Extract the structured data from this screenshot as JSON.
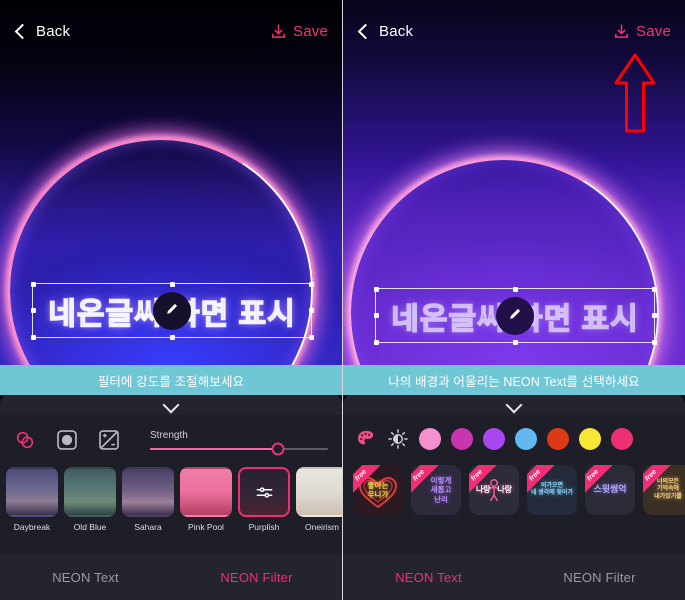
{
  "panels": {
    "left": {
      "topbar": {
        "back_label": "Back",
        "save_label": "Save",
        "back_icon": "chevron-left-icon",
        "save_icon": "download-save-icon"
      },
      "canvas": {
        "neon_text": "네온글씨 화면 표시",
        "edit_icon": "pencil-icon"
      },
      "banner": {
        "text": "필터에 강도를 조절해보세요"
      },
      "sheet": {
        "grabber_icon": "chevron-down-icon",
        "tools": [
          {
            "name": "blend-circles-icon",
            "active": true
          },
          {
            "name": "vignette-icon",
            "active": false
          },
          {
            "name": "exposure-icon",
            "active": false
          }
        ],
        "slider": {
          "label": "Strength",
          "value": 72
        },
        "filters": [
          {
            "label": "Daybreak",
            "selected": false
          },
          {
            "label": "Old Blue",
            "selected": false
          },
          {
            "label": "Sahara",
            "selected": false
          },
          {
            "label": "Pink Pool",
            "selected": false
          },
          {
            "label": "Purplish",
            "selected": true,
            "badge_icon": "sliders-adjust-icon"
          },
          {
            "label": "Oneirism",
            "selected": false
          }
        ]
      },
      "tabs": [
        {
          "label": "NEON Text",
          "active": false
        },
        {
          "label": "NEON Filter",
          "active": true
        }
      ]
    },
    "right": {
      "topbar": {
        "back_label": "Back",
        "save_label": "Save",
        "back_icon": "chevron-left-icon",
        "save_icon": "download-save-icon"
      },
      "annotation": {
        "icon": "red-up-arrow-annotation",
        "color": "#ff0000"
      },
      "canvas": {
        "neon_text": "네온글씨 화면 표시",
        "edit_icon": "pencil-icon"
      },
      "banner": {
        "text": "나의 배경과 어울리는 NEON Text를 선택하세요"
      },
      "sheet": {
        "grabber_icon": "chevron-down-icon",
        "tools": [
          {
            "name": "palette-icon"
          },
          {
            "name": "brightness-icon"
          }
        ],
        "colors": [
          {
            "hex": "#f48fd0"
          },
          {
            "hex": "#c935ae"
          },
          {
            "hex": "#ab47f0"
          },
          {
            "hex": "#62b8f0"
          },
          {
            "hex": "#dc3a17"
          },
          {
            "hex": "#f7e636"
          },
          {
            "hex": "#ef2f74"
          }
        ],
        "stickers": [
          {
            "badge": "free",
            "text": "좋아는\n우니가",
            "color": "#f7d64e"
          },
          {
            "badge": "free",
            "text": "이렇게\n새롭고\n난리",
            "color": "#b78cf0"
          },
          {
            "badge": "free",
            "text": "나랑 나랑",
            "color": "#ffffff"
          },
          {
            "badge": "free",
            "text": "비가오면\n네 생각에 젖어가",
            "color": "#8fd8f5"
          },
          {
            "badge": "free",
            "text": "스윗썸억",
            "color": "#b1a7ef"
          },
          {
            "badge": "free",
            "text": "너의모든\n기억속에\n내가있기를",
            "color": "#f2d08a"
          }
        ]
      },
      "tabs": [
        {
          "label": "NEON Text",
          "active": true
        },
        {
          "label": "NEON Filter",
          "active": false
        }
      ]
    }
  },
  "theme": {
    "accent_pink": "#ef2f74",
    "banner_teal": "#6fc6d4",
    "sheet_bg": "#1e1e28",
    "tabbar_bg": "#24242e",
    "annotation_red": "#ff0000"
  }
}
